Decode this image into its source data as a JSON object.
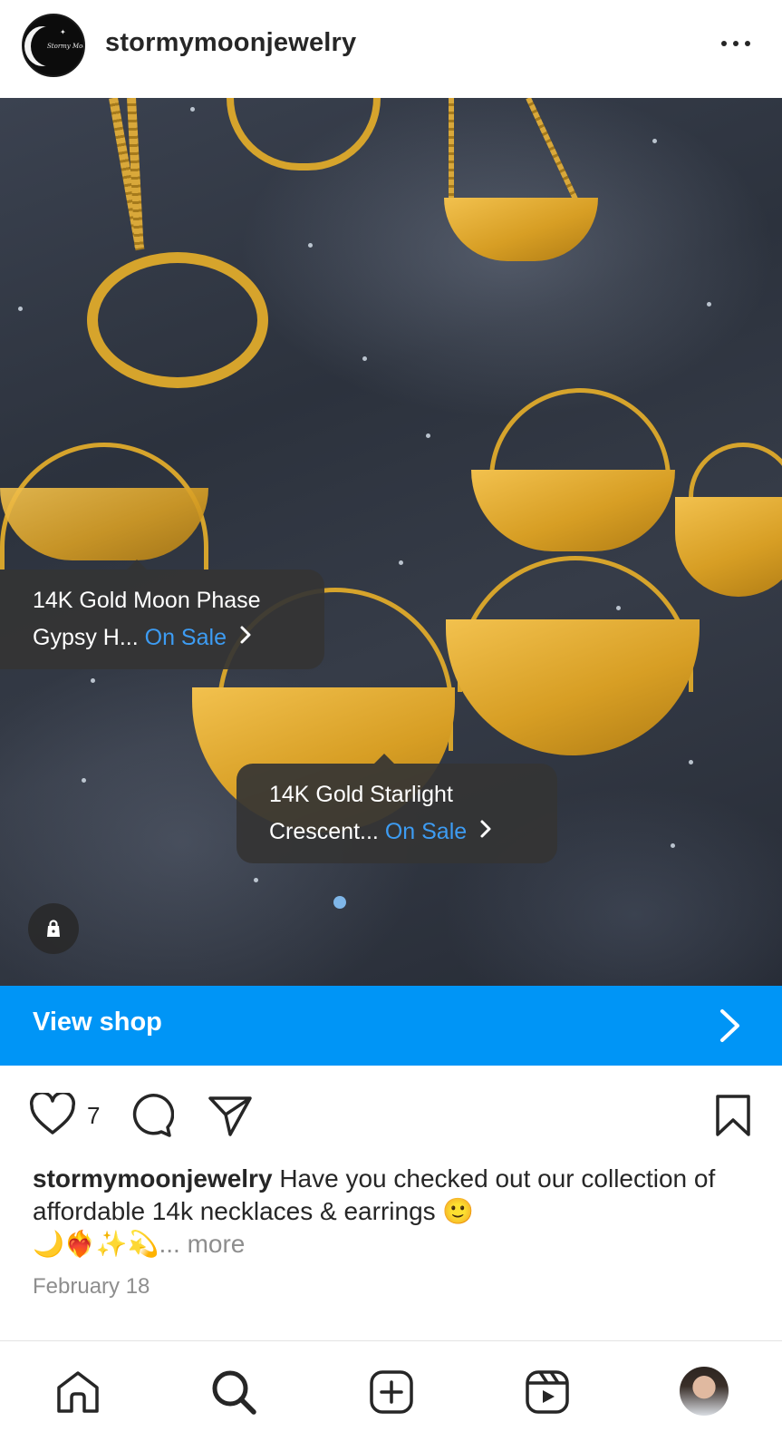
{
  "header": {
    "username": "stormymoonjewelry",
    "avatar_logo_text": "Stormy Moon"
  },
  "product_tags": [
    {
      "line1": "14K Gold Moon Phase",
      "line2": "Gypsy H...",
      "sale": "On Sale"
    },
    {
      "line1": "14K Gold Starlight",
      "line2": "Crescent...",
      "sale": "On Sale"
    }
  ],
  "view_shop": {
    "label": "View shop"
  },
  "actions": {
    "like_count": "7"
  },
  "caption": {
    "user": "stormymoonjewelry",
    "text": "Have you checked out our collection of affordable 14k necklaces & earrings",
    "emoji_line1": "🙂",
    "emoji_line2": "🌙❤️‍🔥✨💫",
    "more": "... more"
  },
  "date": "February 18",
  "colors": {
    "accent": "#0095f6",
    "sale_text": "#3d9cf3",
    "text_primary": "#262626",
    "text_secondary": "#8e8e8e"
  },
  "icons": [
    "more-horizontal-icon",
    "shopping-bag-icon",
    "chevron-right-icon",
    "heart-icon",
    "comment-icon",
    "share-icon",
    "bookmark-icon",
    "home-icon",
    "search-icon",
    "create-icon",
    "reels-icon"
  ]
}
